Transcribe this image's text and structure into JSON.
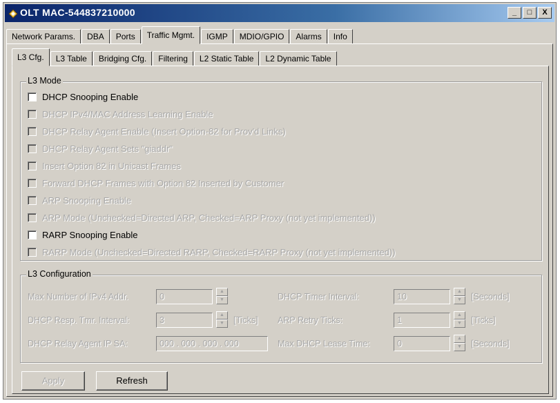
{
  "window": {
    "title": "OLT MAC-544837210000",
    "minimize": "_",
    "restore": "□",
    "close": "X"
  },
  "main_tabs": [
    "Network Params.",
    "DBA",
    "Ports",
    "Traffic Mgmt.",
    "IGMP",
    "MDIO/GPIO",
    "Alarms",
    "Info"
  ],
  "sub_tabs": [
    "L3 Cfg.",
    "L3 Table",
    "Bridging Cfg.",
    "Filtering",
    "L2 Static Table",
    "L2 Dynamic Table"
  ],
  "l3_mode": {
    "title": "L3 Mode",
    "options": [
      {
        "label": "DHCP Snooping Enable",
        "enabled": true,
        "checked": false
      },
      {
        "label": "DHCP IPv4/MAC Address Learning Enable",
        "enabled": false,
        "checked": false
      },
      {
        "label": "DHCP Relay Agent Enable (Insert Option-82 for Prov'd Links)",
        "enabled": false,
        "checked": false
      },
      {
        "label": "DHCP Relay Agent Sets \"giaddr\"",
        "enabled": false,
        "checked": false
      },
      {
        "label": "Insert Option 82 in Unicast Frames",
        "enabled": false,
        "checked": false
      },
      {
        "label": "Forward DHCP Frames with Option 82 Inserted by Customer",
        "enabled": false,
        "checked": false
      },
      {
        "label": "ARP Snooping Enable",
        "enabled": false,
        "checked": false
      },
      {
        "label": "ARP Mode (Unchecked=Directed ARP, Checked=ARP Proxy (not yet implemented))",
        "enabled": false,
        "checked": false
      },
      {
        "label": "RARP Snooping Enable",
        "enabled": true,
        "checked": false
      },
      {
        "label": "RARP Mode (Unchecked=Directed RARP, Checked=RARP Proxy (not yet implemented))",
        "enabled": false,
        "checked": false
      }
    ]
  },
  "l3_config": {
    "title": "L3 Configuration",
    "max_ipv4_label": "Max Number of IPv4 Addr.",
    "max_ipv4_value": "0",
    "dhcp_resp_label": "DHCP Resp. Tmr. Interval:",
    "dhcp_resp_value": "3",
    "dhcp_resp_unit": "[Ticks]",
    "relay_ip_label": "DHCP Relay Agent IP SA:",
    "relay_ip_value": "000 . 000 . 000 . 000",
    "timer_interval_label": "DHCP Timer Interval:",
    "timer_interval_value": "10",
    "timer_interval_unit": "[Seconds]",
    "arp_retry_label": "ARP Retry Ticks:",
    "arp_retry_value": "1",
    "arp_retry_unit": "[Ticks]",
    "lease_label": "Max DHCP Lease Time:",
    "lease_value": "0",
    "lease_unit": "[Seconds]"
  },
  "buttons": {
    "apply": "Apply",
    "refresh": "Refresh"
  }
}
